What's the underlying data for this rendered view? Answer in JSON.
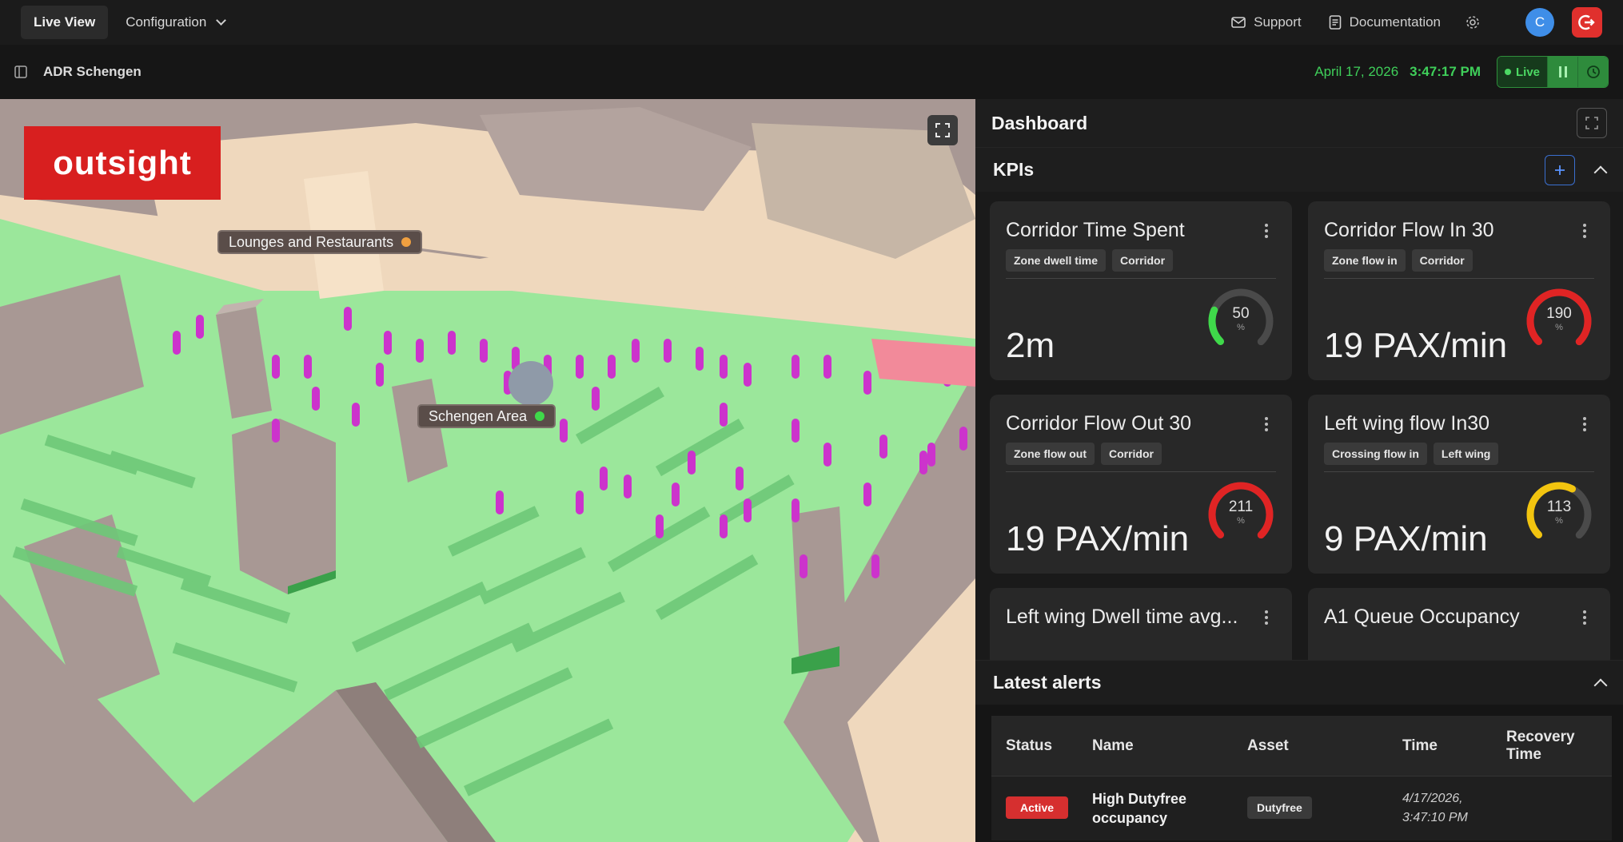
{
  "nav": {
    "tabs": [
      {
        "label": "Live View",
        "active": true
      },
      {
        "label": "Configuration",
        "active": false
      }
    ],
    "support_label": "Support",
    "documentation_label": "Documentation",
    "avatar_initial": "C"
  },
  "subbar": {
    "site_name": "ADR Schengen",
    "date": "April 17, 2026",
    "time": "3:47:17 PM",
    "live_label": "Live"
  },
  "map": {
    "logo_text": "outsight",
    "zones": [
      {
        "label": "Lounges and Restaurants",
        "dot_color": "#f0a040"
      },
      {
        "label": "Schengen Area",
        "dot_color": "#3fd94a"
      }
    ]
  },
  "dashboard": {
    "title": "Dashboard",
    "kpis_title": "KPIs",
    "kpis": [
      {
        "title": "Corridor Time Spent",
        "tags": [
          "Zone dwell time",
          "Corridor"
        ],
        "value": "2m",
        "gauge_value": "50",
        "gauge_unit": "%",
        "gauge_color": "#3fd94a",
        "gauge_fraction": 0.25
      },
      {
        "title": "Corridor Flow In 30",
        "tags": [
          "Zone flow in",
          "Corridor"
        ],
        "value": "19 PAX/min",
        "gauge_value": "190",
        "gauge_unit": "%",
        "gauge_color": "#e02424",
        "gauge_fraction": 1.0
      },
      {
        "title": "Corridor Flow Out 30",
        "tags": [
          "Zone flow out",
          "Corridor"
        ],
        "value": "19 PAX/min",
        "gauge_value": "211",
        "gauge_unit": "%",
        "gauge_color": "#e02424",
        "gauge_fraction": 1.0
      },
      {
        "title": "Left wing flow In30",
        "tags": [
          "Crossing flow in",
          "Left wing"
        ],
        "value": "9 PAX/min",
        "gauge_value": "113",
        "gauge_unit": "%",
        "gauge_color": "#f2c40f",
        "gauge_fraction": 0.6
      },
      {
        "title": "Left wing Dwell time avg...",
        "tags": [],
        "value": "",
        "gauge_value": "",
        "gauge_unit": "",
        "gauge_color": "#555555",
        "gauge_fraction": 0
      },
      {
        "title": "A1 Queue Occupancy",
        "tags": [],
        "value": "",
        "gauge_value": "",
        "gauge_unit": "",
        "gauge_color": "#555555",
        "gauge_fraction": 0
      }
    ],
    "alerts": {
      "title": "Latest alerts",
      "columns": [
        "Status",
        "Name",
        "Asset",
        "Time",
        "Recovery Time"
      ],
      "rows": [
        {
          "status": "Active",
          "name": "High Dutyfree occupancy",
          "asset": "Dutyfree",
          "time": "4/17/2026, 3:47:10 PM",
          "recovery": ""
        }
      ]
    }
  },
  "colors": {
    "accent_green": "#3fcf5a",
    "alert_red": "#d62f2f",
    "brand_red": "#d81f1f"
  }
}
